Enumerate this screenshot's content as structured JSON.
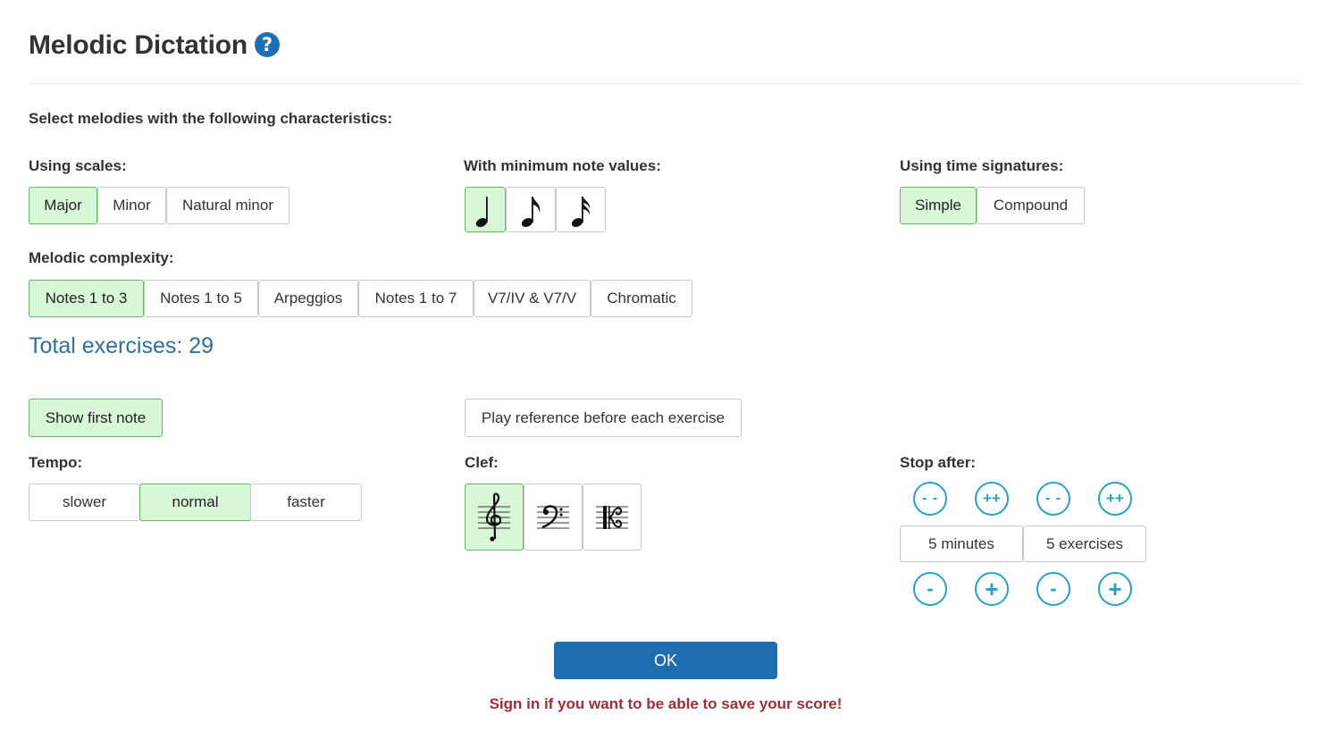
{
  "header": {
    "title": "Melodic Dictation",
    "help_glyph": "?"
  },
  "intro": "Select melodies with the following characteristics:",
  "scales": {
    "label": "Using scales:",
    "options": [
      "Major",
      "Minor",
      "Natural minor"
    ],
    "selected": "Major"
  },
  "note_values": {
    "label": "With minimum note values:",
    "options": [
      "quarter-note-icon",
      "eighth-note-icon",
      "sixteenth-note-icon"
    ],
    "selected": "quarter-note-icon"
  },
  "time_signatures": {
    "label": "Using time signatures:",
    "options": [
      "Simple",
      "Compound"
    ],
    "selected": "Simple"
  },
  "complexity": {
    "label": "Melodic complexity:",
    "options": [
      "Notes 1 to 3",
      "Notes 1 to 5",
      "Arpeggios",
      "Notes 1 to 7",
      "V7/IV & V7/V",
      "Chromatic"
    ],
    "selected": "Notes 1 to 3"
  },
  "total": "Total exercises: 29",
  "toggles": {
    "show_first_note": "Show first note",
    "show_first_note_on": true,
    "play_reference": "Play reference before each exercise",
    "play_reference_on": false
  },
  "tempo": {
    "label": "Tempo:",
    "options": [
      "slower",
      "normal",
      "faster"
    ],
    "selected": "normal"
  },
  "clef": {
    "label": "Clef:",
    "options": [
      "treble-clef-icon",
      "bass-clef-icon",
      "alto-clef-icon"
    ],
    "selected": "treble-clef-icon"
  },
  "stop_after": {
    "label": "Stop after:",
    "minutes": "5 minutes",
    "exercises": "5 exercises",
    "big_decrease_glyph": "- -",
    "big_increase_glyph": "++",
    "decrease_glyph": "-",
    "increase_glyph": "+"
  },
  "ok_label": "OK",
  "signin": "Sign in if you want to be able to save your score!",
  "colors": {
    "selected_bg": "#d7f7d7",
    "selected_border": "#68b768",
    "primary": "#1f6db1",
    "link_teal": "#2aa0c3",
    "warning_text": "#a32d36",
    "total_text": "#2f6f9c"
  }
}
